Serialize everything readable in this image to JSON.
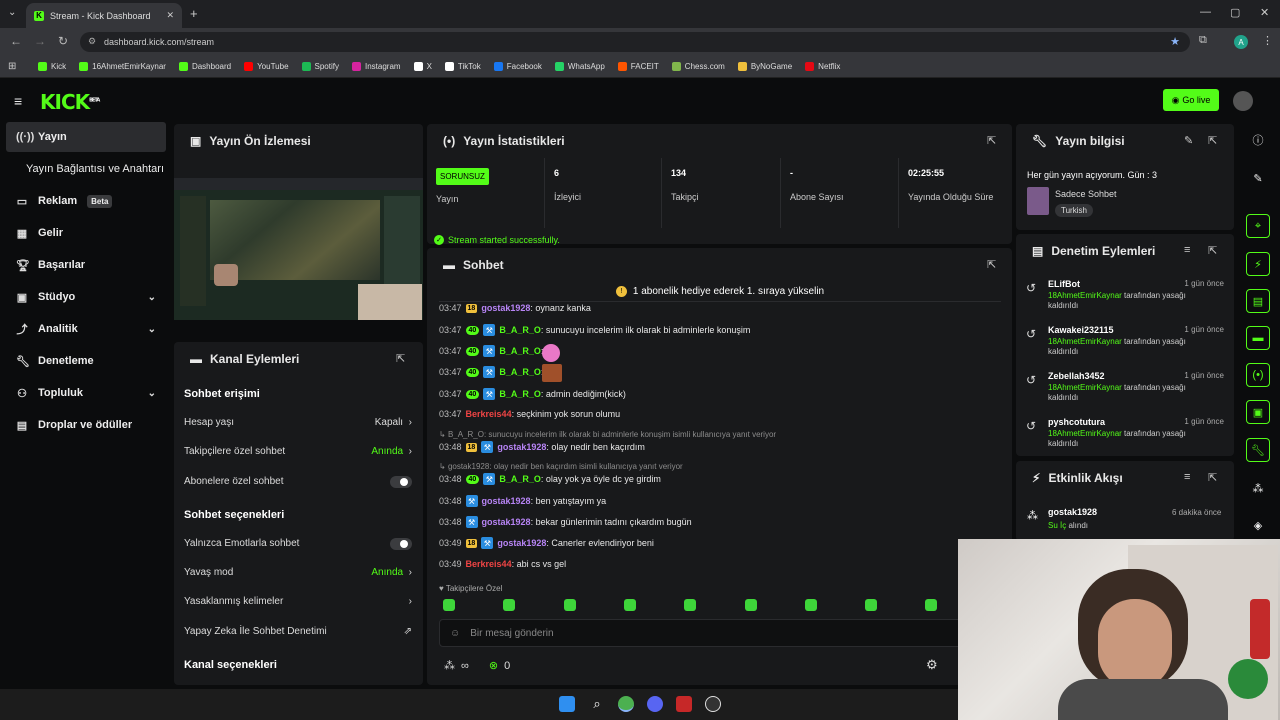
{
  "browser": {
    "tab_title": "Stream - Kick Dashboard",
    "url": "dashboard.kick.com/stream",
    "bookmarks": [
      {
        "label": "Kick",
        "color": "#53fc18"
      },
      {
        "label": "16AhmetEmirKaynar",
        "color": "#53fc18"
      },
      {
        "label": "Dashboard",
        "color": "#53fc18"
      },
      {
        "label": "YouTube",
        "color": "#ff0000"
      },
      {
        "label": "Spotify",
        "color": "#1db954"
      },
      {
        "label": "Instagram",
        "color": "#d6249f"
      },
      {
        "label": "X",
        "color": "#ffffff"
      },
      {
        "label": "TikTok",
        "color": "#ffffff"
      },
      {
        "label": "Facebook",
        "color": "#1877f2"
      },
      {
        "label": "WhatsApp",
        "color": "#25d366"
      },
      {
        "label": "FACEIT",
        "color": "#ff5500"
      },
      {
        "label": "Chess.com",
        "color": "#81b64c"
      },
      {
        "label": "ByNoGame",
        "color": "#f0c03c"
      },
      {
        "label": "Netflix",
        "color": "#e50914"
      }
    ]
  },
  "header": {
    "logo": "KICK",
    "logo_sup": "BETA",
    "go_live": "Go live"
  },
  "sidebar": {
    "items": [
      {
        "label": "Yayın"
      },
      {
        "label": "Yayın Bağlantısı ve Anahtarı"
      },
      {
        "label": "Reklam",
        "badge": "Beta"
      },
      {
        "label": "Gelir"
      },
      {
        "label": "Başarılar"
      },
      {
        "label": "Stüdyo"
      },
      {
        "label": "Analitik"
      },
      {
        "label": "Denetleme"
      },
      {
        "label": "Topluluk"
      },
      {
        "label": "Droplar ve ödüller"
      }
    ]
  },
  "preview": {
    "title": "Yayın Ön İzlemesi"
  },
  "channel_actions": {
    "title": "Kanal Eylemleri",
    "chat_access": "Sohbet erişimi",
    "account_age": "Hesap yaşı",
    "account_age_value": "Kapalı",
    "followers_chat": "Takipçilere özel sohbet",
    "followers_chat_value": "Anında",
    "subs_chat": "Abonelere özel sohbet",
    "chat_options": "Sohbet seçenekleri",
    "emote_only": "Yalnızca Emotlarla sohbet",
    "slow_mode": "Yavaş mod",
    "slow_mode_value": "Anında",
    "banned_words": "Yasaklanmış kelimeler",
    "ai_moderation": "Yapay Zeka İle Sohbet Denetimi",
    "channel_options": "Kanal seçenekleri"
  },
  "stats": {
    "title": "Yayın İstatistikleri",
    "status_badge": "SORUNSUZ",
    "status_label": "Yayın",
    "viewers": "6",
    "viewers_label": "İzleyici",
    "followers": "134",
    "followers_label": "Takipçi",
    "subs": "-",
    "subs_label": "Abone Sayısı",
    "uptime": "02:25:55",
    "uptime_label": "Yayında Olduğu Süre",
    "success": "Stream started successfully."
  },
  "chat": {
    "title": "Sohbet",
    "pinned": "1 abonelik hediye ederek 1. sıraya yükselin",
    "messages": [
      {
        "time": "03:47",
        "badges": [
          "18"
        ],
        "user": "gostak1928",
        "color": "#b784f5",
        "text": ": oynanz kanka"
      },
      {
        "time": "03:47",
        "badges": [
          "40",
          "mod"
        ],
        "user": "B_A_R_O",
        "color": "#53fc18",
        "text": ": sunucuyu incelerim ilk olarak bi adminlerle konuşim"
      },
      {
        "time": "03:47",
        "badges": [
          "40",
          "mod"
        ],
        "user": "B_A_R_O",
        "color": "#53fc18",
        "text": ":"
      },
      {
        "time": "03:47",
        "badges": [
          "40",
          "mod"
        ],
        "user": "B_A_R_O",
        "color": "#53fc18",
        "text": ":"
      },
      {
        "time": "03:47",
        "badges": [
          "40",
          "mod"
        ],
        "user": "B_A_R_O",
        "color": "#53fc18",
        "text": ": admin dediğim(kick)"
      },
      {
        "time": "03:47",
        "badges": [],
        "user": "Berkreis44",
        "color": "#ef4444",
        "text": ": seçkinim yok sorun olumu"
      },
      {
        "time": "03:48",
        "badges": [
          "18",
          "mod"
        ],
        "user": "gostak1928",
        "color": "#b784f5",
        "text": ": olay nedir ben kaçırdım"
      },
      {
        "time": "03:48",
        "badges": [
          "40",
          "mod"
        ],
        "user": "B_A_R_O",
        "color": "#53fc18",
        "text": ": olay yok ya öyle dc ye girdim"
      },
      {
        "time": "03:48",
        "badges": [
          "mod"
        ],
        "user": "gostak1928",
        "color": "#b784f5",
        "text": ": ben yatıştayım ya"
      },
      {
        "time": "03:48",
        "badges": [
          "mod"
        ],
        "user": "gostak1928",
        "color": "#b784f5",
        "text": ": bekar günlerimin tadını çıkardım bugün"
      },
      {
        "time": "03:49",
        "badges": [
          "18",
          "mod"
        ],
        "user": "gostak1928",
        "color": "#b784f5",
        "text": ": Canerler evlendiriyor beni"
      },
      {
        "time": "03:49",
        "badges": [],
        "user": "Berkreis44",
        "color": "#ef4444",
        "text": ": abi cs vs gel"
      }
    ],
    "reply1": "B_A_R_O: sunucuyu incelerim ilk olarak bi adminlerle konuşim isimli kullanıcıya yanıt veriyor",
    "reply2": "gostak1928: olay nedir ben kaçırdım isimli kullanıcıya yanıt veriyor",
    "followers_only": "Takipçilere Özel",
    "input_placeholder": "Bir mesaj gönderin",
    "infinity": "∞",
    "points": "0"
  },
  "stream_info": {
    "title": "Yayın bilgisi",
    "stream_title": "Her gün yayın açıyorum. Gün : 3",
    "category": "Sadece Sohbet",
    "language": "Turkish"
  },
  "mod_actions": {
    "title": "Denetim Eylemleri",
    "rows": [
      {
        "name": "ELifBot",
        "time": "1 gün önce",
        "by": "18AhmetEmirKaynar",
        "desc1": " tarafından yasağı",
        "desc2": "kaldırıldı"
      },
      {
        "name": "Kawakei232115",
        "time": "1 gün önce",
        "by": "18AhmetEmirKaynar",
        "desc1": " tarafından yasağı",
        "desc2": "kaldırıldı"
      },
      {
        "name": "Zebellah3452",
        "time": "1 gün önce",
        "by": "18AhmetEmirKaynar",
        "desc1": " tarafından yasağı",
        "desc2": "kaldırıldı"
      },
      {
        "name": "pyshcotutura",
        "time": "1 gün önce",
        "by": "18AhmetEmirKaynar",
        "desc1": " tarafından yasağı",
        "desc2": "kaldırıldı"
      }
    ]
  },
  "activity": {
    "title": "Etkinlik Akışı",
    "user": "gostak1928",
    "time": "6 dakika önce",
    "action_prefix": "Su İç",
    "action_suffix": " alındı"
  }
}
